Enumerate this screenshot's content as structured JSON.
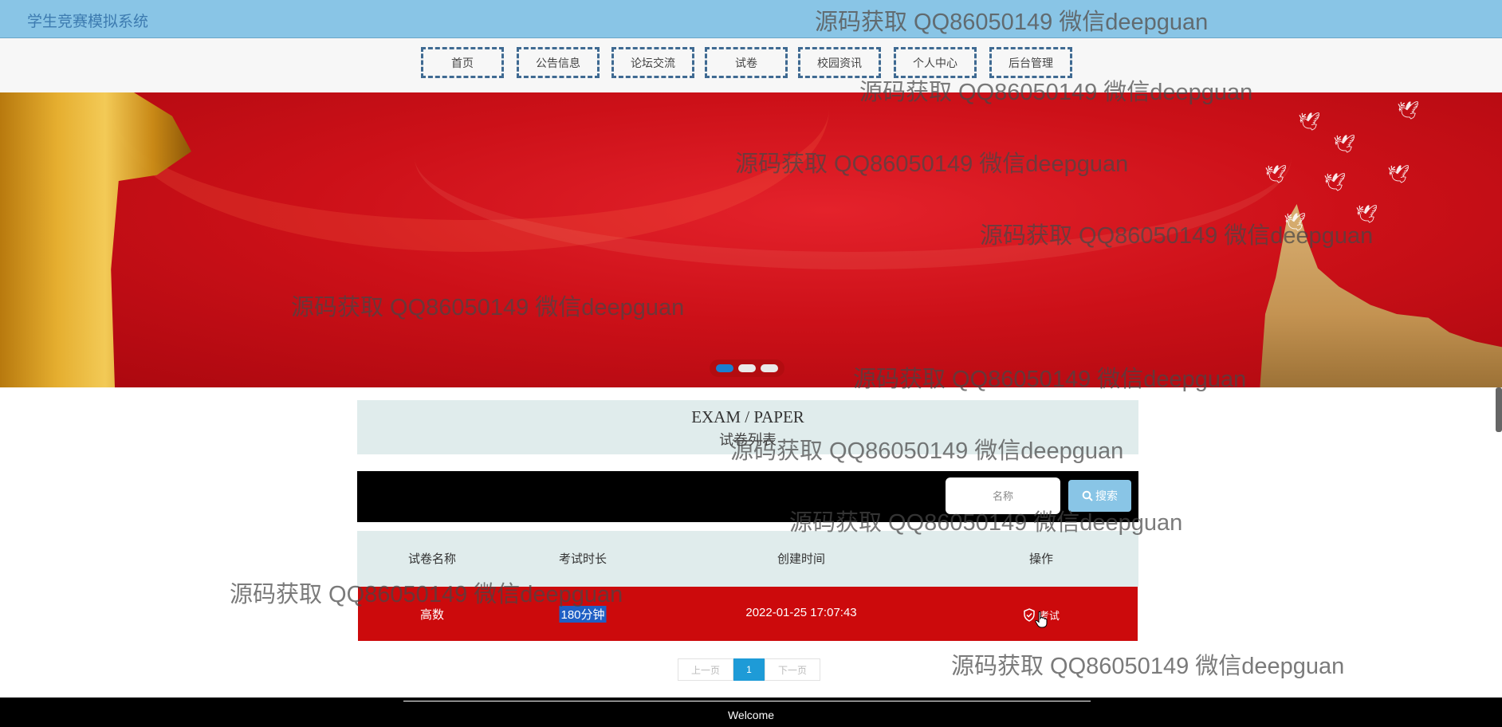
{
  "app": {
    "title": "学生竞赛模拟系统"
  },
  "nav": {
    "items": [
      {
        "label": "首页"
      },
      {
        "label": "公告信息"
      },
      {
        "label": "论坛交流"
      },
      {
        "label": "试卷"
      },
      {
        "label": "校园资讯"
      },
      {
        "label": "个人中心"
      },
      {
        "label": "后台管理"
      }
    ]
  },
  "banner": {
    "slides": 3,
    "active_slide": 1
  },
  "section": {
    "title_en": "EXAM / PAPER",
    "title_cn": "试卷列表"
  },
  "search": {
    "placeholder": "名称",
    "button_label": "搜索"
  },
  "table": {
    "headers": [
      "试卷名称",
      "考试时长",
      "创建时间",
      "操作"
    ],
    "rows": [
      {
        "name": "高数",
        "duration": "180分钟",
        "created": "2022-01-25 17:07:43",
        "action": "考试"
      }
    ]
  },
  "pagination": {
    "prev": "上一页",
    "current": "1",
    "next": "下一页"
  },
  "footer": {
    "text": "Welcome"
  },
  "watermark": {
    "text": "源码获取 QQ86050149 微信deepguan"
  },
  "colors": {
    "topbar": "#89c5e6",
    "banner": "#cc1018",
    "row": "#cc0a0c",
    "accent": "#1e9bd7"
  }
}
